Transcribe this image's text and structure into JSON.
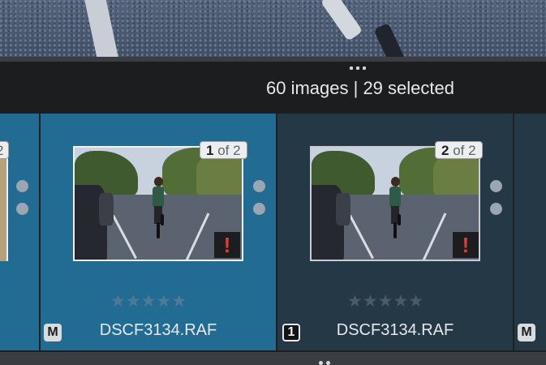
{
  "status": {
    "text": "60 images | 29 selected"
  },
  "filmstrip": {
    "partial_left": {
      "count_total": "2"
    },
    "cells": [
      {
        "index": "1",
        "of_text": " of 2",
        "warning": "!",
        "rating": 0,
        "stars": "★★★★★",
        "filename": "DSCF3134.RAF",
        "badge": "M",
        "selected": true
      },
      {
        "index": "2",
        "of_text": " of 2",
        "warning": "!",
        "rating": 0,
        "stars": "★★★★★",
        "filename": "DSCF3134.RAF",
        "badge": "1",
        "selected": false
      }
    ],
    "partial_right": {
      "badge": "M"
    }
  },
  "colors": {
    "selected_cell": "#226c94",
    "cell": "#243845",
    "warning": "#e23b3b"
  },
  "icons": [
    "resize-grip-icon",
    "warning-icon",
    "star-icon",
    "menu-dots-icon"
  ]
}
